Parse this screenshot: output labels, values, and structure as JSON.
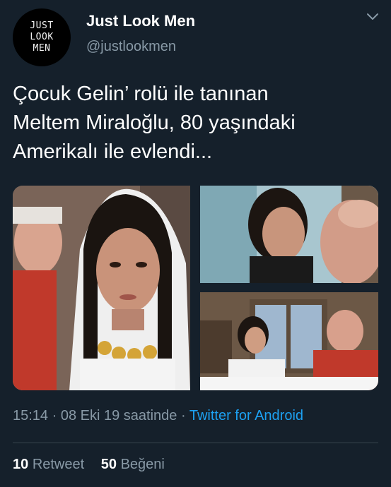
{
  "author": {
    "avatar_lines": [
      "JUST",
      "LOOK",
      "MEN"
    ],
    "display_name": "Just Look Men",
    "handle": "@justlookmen"
  },
  "tweet": {
    "text_lines": [
      "Çocuk Gelin’ rolü ile tanınan",
      "Meltem Miraloğlu, 80 yaşındaki",
      "Amerikalı ile evlendi..."
    ]
  },
  "media": {
    "photos": [
      "photo-bride",
      "photo-couple-closeup",
      "photo-couple-home"
    ]
  },
  "meta": {
    "time": "15:14",
    "date": "08 Eki 19 saatinde",
    "separator": " · ",
    "source": "Twitter for Android"
  },
  "stats": {
    "retweets_count": "10",
    "retweets_label": "Retweet",
    "likes_count": "50",
    "likes_label": "Beğeni"
  },
  "colors": {
    "background": "#15202b",
    "secondary_text": "#8899a6",
    "link": "#1da1f2",
    "divider": "#38444d"
  },
  "icons": {
    "caret": "chevron-down-icon"
  }
}
